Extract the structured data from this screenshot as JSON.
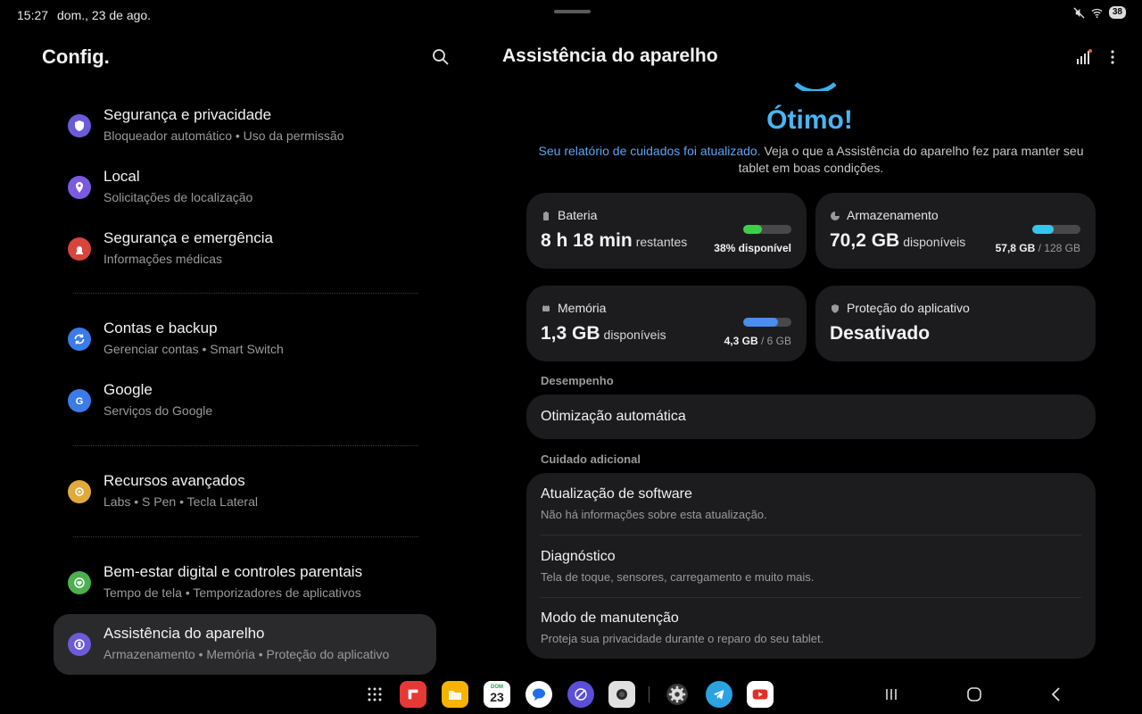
{
  "status_bar": {
    "time": "15:27",
    "date": "dom., 23 de ago.",
    "battery_level": "38",
    "icons": [
      "mute-icon",
      "wifi-icon",
      "battery-icon"
    ]
  },
  "left_pane": {
    "title": "Config.",
    "items": [
      {
        "title": "Segurança e privacidade",
        "subtitle": "Bloqueador automático  •  Uso da permissão",
        "icon": "shield-icon",
        "color": "#6b5bd9"
      },
      {
        "title": "Local",
        "subtitle": "Solicitações de localização",
        "icon": "location-pin-icon",
        "color": "#7a5be0"
      },
      {
        "title": "Segurança e emergência",
        "subtitle": "Informações médicas",
        "icon": "emergency-icon",
        "color": "#d8453c"
      },
      {
        "title": "Contas e backup",
        "subtitle": "Gerenciar contas  •  Smart Switch",
        "icon": "sync-icon",
        "color": "#3b7be8"
      },
      {
        "title": "Google",
        "subtitle": "Serviços do Google",
        "icon": "google-icon",
        "color": "#3b7be8"
      },
      {
        "title": "Recursos avançados",
        "subtitle": "Labs  •  S Pen  •  Tecla Lateral",
        "icon": "star-gear-icon",
        "color": "#e0a93c"
      },
      {
        "title": "Bem-estar digital e controles parentais",
        "subtitle": "Tempo de tela  •  Temporizadores de aplicativos",
        "icon": "heart-icon",
        "color": "#4caf50"
      },
      {
        "title": "Assistência do aparelho",
        "subtitle": "Armazenamento  •  Memória  •  Proteção do aplicativo",
        "icon": "device-care-icon",
        "color": "#6b5bd9"
      }
    ]
  },
  "right_pane": {
    "title": "Assistência do aparelho",
    "status": "Ótimo!",
    "report_link": "Seu relatório de cuidados foi atualizado.",
    "report_text": " Veja o que a Assistência do aparelho fez para manter seu tablet em boas condições.",
    "cards": {
      "battery": {
        "label": "Bateria",
        "value": "8 h 18 min",
        "unit": "restantes",
        "detail": "38% disponível",
        "fill_fraction": 0.38,
        "color": "#3ecf4a"
      },
      "storage": {
        "label": "Armazenamento",
        "value": "70,2 GB",
        "unit": "disponíveis",
        "used": "57,8 GB",
        "total": " / 128 GB",
        "fill_fraction": 0.45,
        "color": "#35c6e8"
      },
      "memory": {
        "label": "Memória",
        "value": "1,3 GB",
        "unit": "disponíveis",
        "used": "4,3 GB",
        "total": " / 6 GB",
        "fill_fraction": 0.72,
        "color": "#4a8cf0"
      },
      "protection": {
        "label": "Proteção do aplicativo",
        "value": "Desativado"
      }
    },
    "performance": {
      "header": "Desempenho",
      "item": "Otimização automática"
    },
    "additional_care": {
      "header": "Cuidado adicional",
      "items": [
        {
          "title": "Atualização de software",
          "subtitle": "Não há informações sobre esta atualização."
        },
        {
          "title": "Diagnóstico",
          "subtitle": "Tela de toque, sensores, carregamento e muito mais."
        },
        {
          "title": "Modo de manutenção",
          "subtitle": "Proteja sua privacidade durante o reparo do seu tablet."
        }
      ]
    }
  },
  "dock": {
    "calendar_day": "23",
    "calendar_weekday": "DOM",
    "apps": [
      "app-drawer-icon",
      "flipboard-icon",
      "files-icon",
      "calendar-icon",
      "messages-icon",
      "browser-icon",
      "camera-icon",
      "settings-icon",
      "telegram-icon",
      "youtube-icon"
    ]
  }
}
